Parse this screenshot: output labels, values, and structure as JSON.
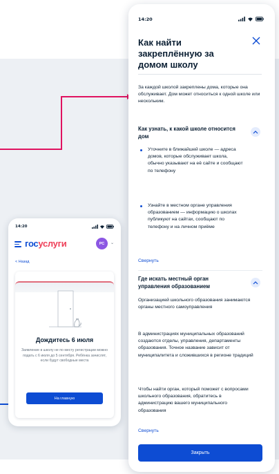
{
  "colors": {
    "accent": "#0d4cd3",
    "connector": "#e0115f",
    "backdrop": "#edf0f4",
    "logo_second": "#ee3f58",
    "avatar": "#8c57e3"
  },
  "small_phone": {
    "status_time": "14:20",
    "logo_part1": "гос",
    "logo_part2": "услуги",
    "avatar_initials": "РС",
    "back_link": "< Назад",
    "card_title": "Дождитесь 6 июля",
    "card_text": "Заявление в школу не по месту регистрации можно подать с 6 июля до 5 сентября. Ребёнка зачислят, если будут свободные места",
    "button_label": "На главную",
    "icons": [
      "menu-icon",
      "signal-icon",
      "wifi-icon",
      "battery-icon",
      "chevron-down-icon"
    ]
  },
  "large_phone": {
    "status_time": "14:20",
    "title": "Как найти закреплённую за домом школу",
    "intro": "За каждой школой закреплены дома, которые она обслуживает. Дом может относиться к одной школе или нескольким.",
    "section1": {
      "heading": "Как узнать, к какой школе относится дом",
      "bullets": [
        "Уточните в ближайшей школе — адреса домов, которые обслуживает школа, обычно указывают на её сайте и сообщают по телефону",
        "Узнайте в местном органе управления образованием — информацию о школах публикуют на сайтах, сообщают по телефону и на личном приёме"
      ],
      "collapse_label": "Свернуть"
    },
    "section2": {
      "heading": "Где искать местный орган управления образованием",
      "paragraphs": [
        "Организацией школьного образования занимаются органы местного самоуправления",
        "В администрациях муниципальных образований создаются отделы, управления, департаменты образования. Точное название зависит от муниципалитета и сложившихся в регионе традиций",
        "Чтобы найти орган, который поможет с вопросами школьного образования, обратитесь в администрацию вашего муниципального образования"
      ],
      "collapse_label": "Свернуть"
    },
    "close_button_label": "Закрыть",
    "icons": [
      "close-icon",
      "chevron-up-icon",
      "signal-icon",
      "wifi-icon",
      "battery-icon"
    ]
  }
}
